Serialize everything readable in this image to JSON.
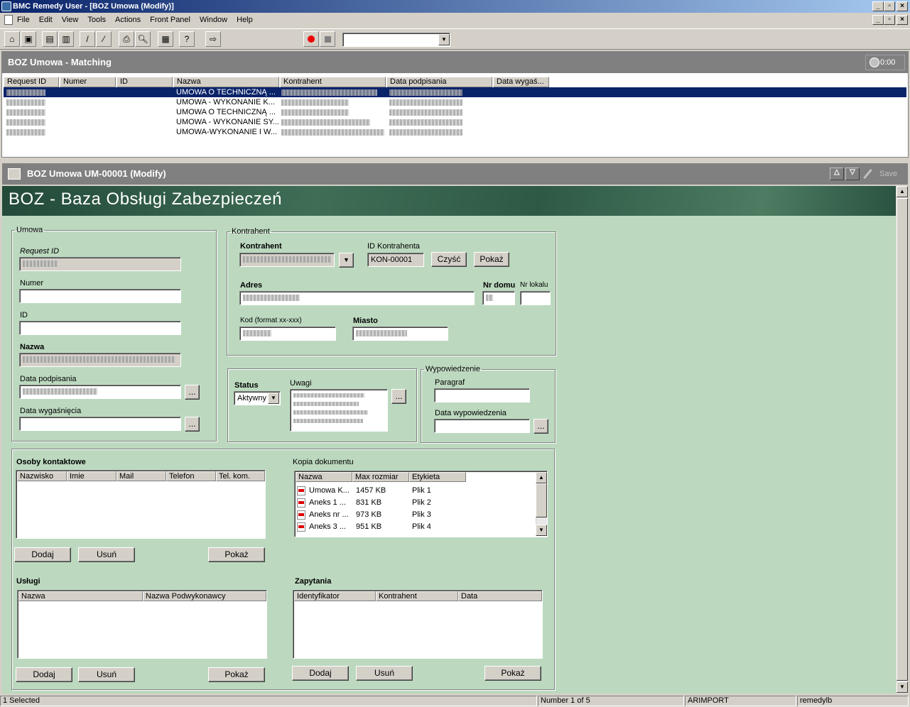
{
  "app": {
    "title": "BMC Remedy User - [BOZ Umowa (Modify)]"
  },
  "menu": [
    "File",
    "Edit",
    "View",
    "Tools",
    "Actions",
    "Front Panel",
    "Window",
    "Help"
  ],
  "toolbar": {
    "combo_value": ""
  },
  "matching": {
    "title": "BOZ Umowa - Matching",
    "timer": "0:00",
    "columns": [
      "Request ID",
      "Numer",
      "ID",
      "Nazwa",
      "Kontrahent",
      "Data podpisania",
      "Data wygaś..."
    ],
    "rows": [
      {
        "nazwa": "UMOWA O TECHNICZNĄ ..."
      },
      {
        "nazwa": "UMOWA - WYKONANIE K..."
      },
      {
        "nazwa": "UMOWA O TECHNICZNĄ ..."
      },
      {
        "nazwa": "UMOWA - WYKONANIE SY..."
      },
      {
        "nazwa": "UMOWA-WYKONANIE I W..."
      }
    ]
  },
  "form": {
    "title": "BOZ Umowa UM-00001 (Modify)",
    "save_label": "Save",
    "banner": "BOZ - Baza Obsługi Zabezpieczeń",
    "umowa": {
      "legend": "Umowa",
      "request_id_label": "Request ID",
      "numer_label": "Numer",
      "id_label": "ID",
      "nazwa_label": "Nazwa",
      "data_podpisania_label": "Data podpisania",
      "data_wygasniecia_label": "Data wygaśnięcia",
      "dots": "..."
    },
    "kontrahent": {
      "legend": "Kontrahent",
      "kontrahent_label": "Kontrahent",
      "id_kontrahenta_label": "ID Kontrahenta",
      "id_kontrahenta_value": "KON-00001",
      "czysc": "Czyść",
      "pokaz": "Pokaż",
      "adres_label": "Adres",
      "nr_domu_label": "Nr domu",
      "nr_lokalu_label": "Nr lokalu",
      "kod_label": "Kod (format xx-xxx)",
      "miasto_label": "Miasto"
    },
    "status": {
      "label": "Status",
      "value": "Aktywny",
      "uwagi_label": "Uwagi"
    },
    "wypowiedzenie": {
      "legend": "Wypowiedzenie",
      "paragraf_label": "Paragraf",
      "data_label": "Data wypowiedzenia"
    },
    "osoby": {
      "title": "Osoby kontaktowe",
      "columns": [
        "Nazwisko",
        "Imie",
        "Mail",
        "Telefon",
        "Tel. kom."
      ],
      "dodaj": "Dodaj",
      "usun": "Usuń",
      "pokaz": "Pokaż"
    },
    "kopia": {
      "title": "Kopia dokumentu",
      "columns": [
        "Nazwa",
        "Max rozmiar",
        "Etykieta"
      ],
      "rows": [
        {
          "nazwa": "Umowa K...",
          "size": "1457 KB",
          "label": "Plik 1"
        },
        {
          "nazwa": "Aneks 1 ...",
          "size": "831 KB",
          "label": "Plik 2"
        },
        {
          "nazwa": "Aneks nr ...",
          "size": "973 KB",
          "label": "Plik 3"
        },
        {
          "nazwa": "Aneks 3 ...",
          "size": "951 KB",
          "label": "Plik 4"
        }
      ]
    },
    "uslugi": {
      "title": "Usługi",
      "columns": [
        "Nazwa",
        "Nazwa Podwykonawcy"
      ],
      "dodaj": "Dodaj",
      "usun": "Usuń",
      "pokaz": "Pokaż"
    },
    "zapytania": {
      "title": "Zapytania",
      "columns": [
        "Identyfikator",
        "Kontrahent",
        "Data"
      ],
      "dodaj": "Dodaj",
      "usun": "Usuń",
      "pokaz": "Pokaż"
    }
  },
  "status": {
    "selected": "1 Selected",
    "number": "Number 1 of 5",
    "server": "ARIMPORT",
    "user": "remedylb"
  }
}
